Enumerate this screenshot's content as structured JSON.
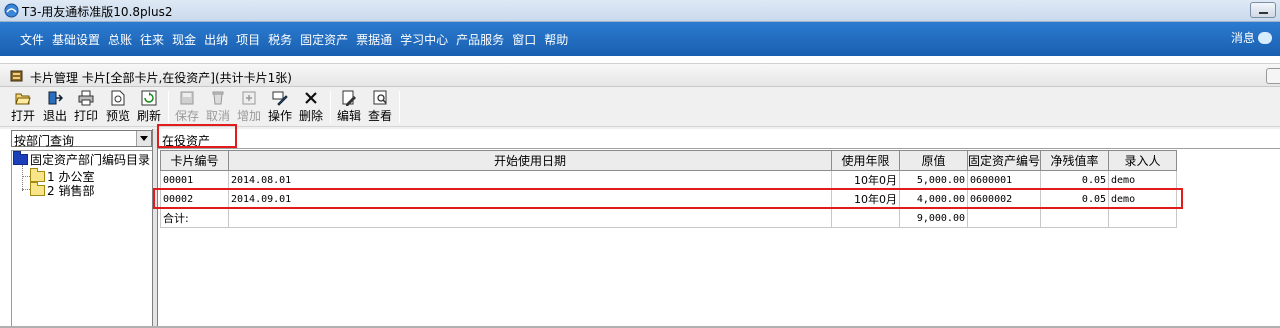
{
  "app": {
    "title": "T3-用友通标准版10.8plus2"
  },
  "menu": {
    "items": [
      "文件",
      "基础设置",
      "总账",
      "往来",
      "现金",
      "出纳",
      "项目",
      "税务",
      "固定资产",
      "票据通",
      "学习中心",
      "产品服务",
      "窗口",
      "帮助"
    ],
    "message_label": "消息"
  },
  "window": {
    "title": "卡片管理 卡片[全部卡片,在役资产](共计卡片1张)"
  },
  "toolbar": {
    "open": "打开",
    "exit": "退出",
    "print": "打印",
    "preview": "预览",
    "refresh": "刷新",
    "save": "保存",
    "cancel": "取消",
    "add": "增加",
    "operate": "操作",
    "delete": "删除",
    "edit": "编辑",
    "view": "查看"
  },
  "left": {
    "query_mode": "按部门查询",
    "tree": {
      "root": "固定资产部门编码目录",
      "children": [
        "1 办公室",
        "2 销售部"
      ]
    }
  },
  "filter": {
    "status": "在役资产"
  },
  "grid": {
    "headers": [
      "卡片编号",
      "开始使用日期",
      "使用年限",
      "原值",
      "固定资产编号",
      "净残值率",
      "录入人"
    ],
    "rows": [
      {
        "card_no": "00001",
        "start_date": "2014.08.01",
        "years": "10年0月",
        "value": "5,000.00",
        "asset_no": "0600001",
        "residual": "0.05",
        "user": "demo"
      },
      {
        "card_no": "00002",
        "start_date": "2014.09.01",
        "years": "10年0月",
        "value": "4,000.00",
        "asset_no": "0600002",
        "residual": "0.05",
        "user": "demo"
      }
    ],
    "total": {
      "label": "合计:",
      "value": "9,000.00"
    }
  },
  "colors": {
    "menubar": "#1a5fb0",
    "highlight": "#e21b1b",
    "root_folder": "#1a3fb8",
    "sub_folder": "#f8e58a"
  }
}
